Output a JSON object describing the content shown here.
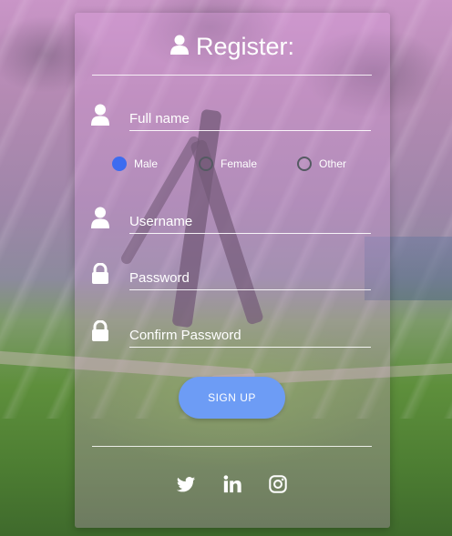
{
  "form": {
    "title": "Register:",
    "fields": {
      "fullname": {
        "placeholder": "Full name",
        "icon": "user-icon"
      },
      "username": {
        "placeholder": "Username",
        "icon": "user-icon"
      },
      "password": {
        "placeholder": "Password",
        "icon": "lock-icon"
      },
      "confirm_password": {
        "placeholder": "Confirm Password",
        "icon": "lock-icon"
      }
    },
    "gender": {
      "options": [
        "Male",
        "Female",
        "Other"
      ],
      "selected": "Male"
    },
    "submit_label": "SIGN UP",
    "social": [
      "twitter-icon",
      "linkedin-icon",
      "instagram-icon"
    ]
  },
  "colors": {
    "accent": "#3d6cf0",
    "button": "#6d9cf5",
    "text": "#ffffff"
  }
}
